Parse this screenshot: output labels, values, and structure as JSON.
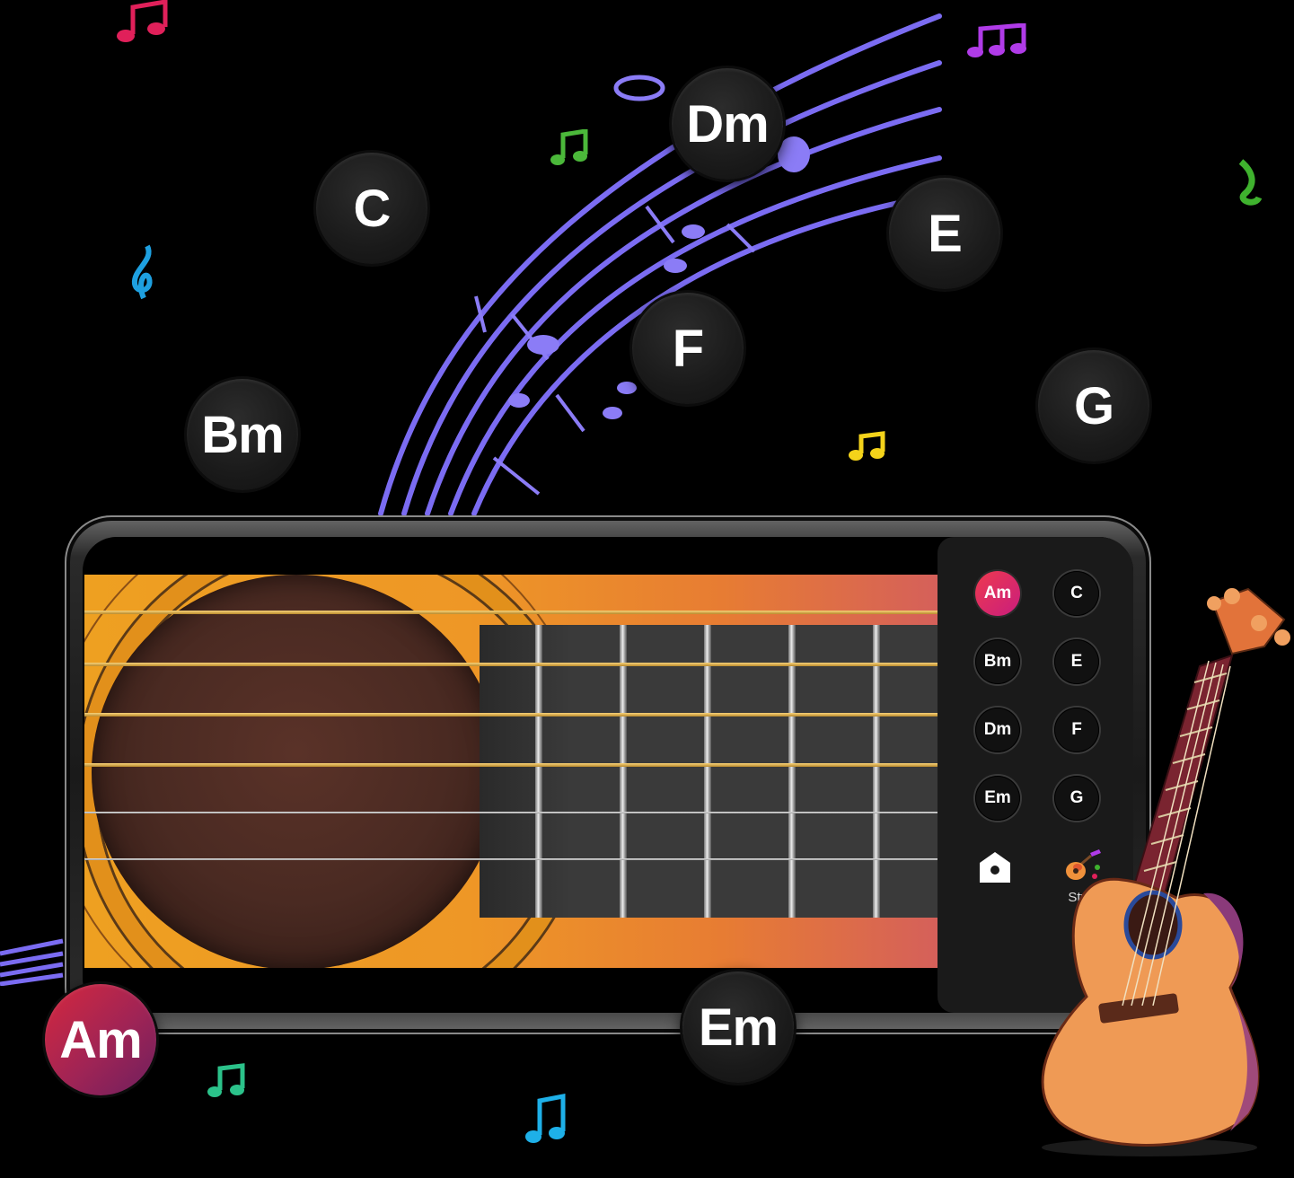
{
  "bubbles": {
    "dm": "Dm",
    "c": "C",
    "e": "E",
    "f": "F",
    "g": "G",
    "bm": "Bm",
    "am": "Am",
    "em": "Em"
  },
  "panel": {
    "chords": [
      "Am",
      "C",
      "Bm",
      "E",
      "Dm",
      "F",
      "Em",
      "G"
    ],
    "selected": "Am",
    "home_icon": "home-icon",
    "style_label": "Style"
  },
  "colors": {
    "accent": "#e02a4a",
    "staff": "#7b6cf2",
    "guitar_orange": "#ee9726",
    "panel_bg": "#1a1a1a"
  }
}
